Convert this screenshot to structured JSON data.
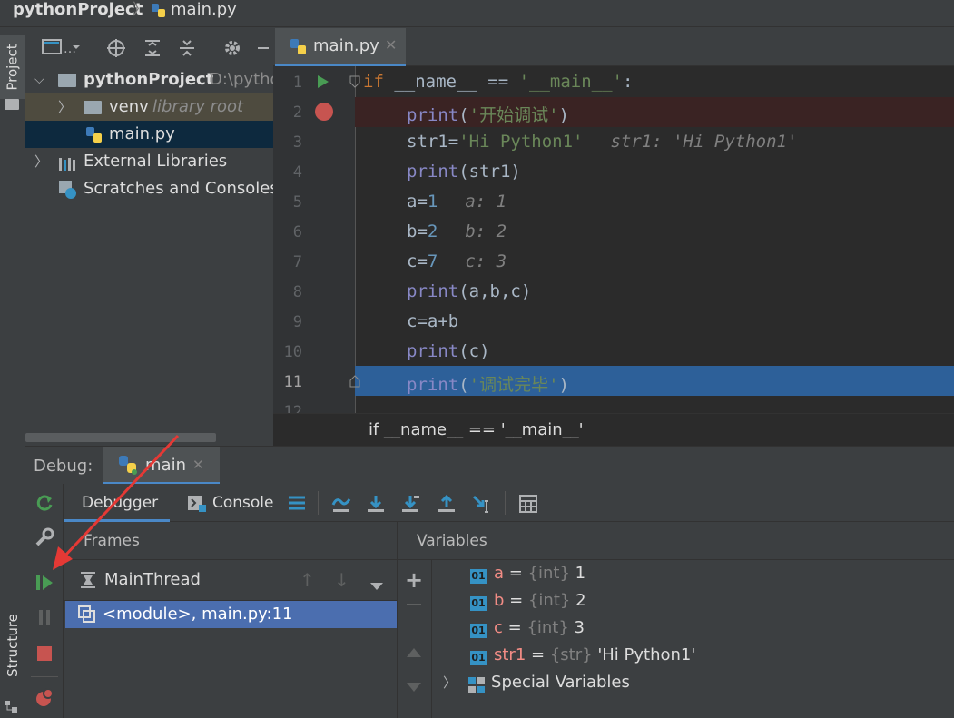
{
  "navbar": {
    "project": "pythonProject",
    "file": "main.py"
  },
  "side_tabs": {
    "project": "Project",
    "structure": "Structure"
  },
  "project_tree": {
    "root_name": "pythonProject",
    "root_path": "D:\\pytho",
    "venv": "venv",
    "venv_note": "library root",
    "file": "main.py",
    "ext_libs": "External Libraries",
    "scratches": "Scratches and Consoles"
  },
  "editor": {
    "tab_label": "main.py",
    "line_numbers": [
      "1",
      "2",
      "3",
      "4",
      "5",
      "6",
      "7",
      "8",
      "9",
      "10",
      "11",
      "12"
    ],
    "lines": [
      {
        "a": "if",
        "b": " __name__ == ",
        "c": "'__main__'",
        "d": ":"
      },
      {
        "a": "print",
        "b": "(",
        "c": "'开始调试'",
        "d": ")"
      },
      {
        "a": "str1=",
        "c": "'Hi Python1'",
        "inline": "str1: 'Hi Python1'"
      },
      {
        "a": "print",
        "b": "(str1)"
      },
      {
        "a": "a=",
        "c": "1",
        "inline": "a: 1"
      },
      {
        "a": "b=",
        "c": "2",
        "inline": "b: 2"
      },
      {
        "a": "c=",
        "c": "7",
        "inline": "c: 3"
      },
      {
        "a": "print",
        "b": "(a,b,c)"
      },
      {
        "a": "c=a+b"
      },
      {
        "a": "print",
        "b": "(c)"
      },
      {
        "a": "print",
        "b": "(",
        "c": "'调试完毕'",
        "d": ")"
      }
    ],
    "status": "if __name__ == '__main__'",
    "colors": {
      "breakpoint": "#c75450",
      "current_line": "#2d6099",
      "bp_line": "#3a2323"
    }
  },
  "debug": {
    "title": "Debug:",
    "config_tab": "main",
    "tabs": {
      "debugger": "Debugger",
      "console": "Console"
    },
    "frames_label": "Frames",
    "variables_label": "Variables",
    "thread": "MainThread",
    "frame": "<module>, main.py:11",
    "variables": [
      {
        "name": "a",
        "type": "{int}",
        "value": "1"
      },
      {
        "name": "b",
        "type": "{int}",
        "value": "2"
      },
      {
        "name": "c",
        "type": "{int}",
        "value": "3"
      },
      {
        "name": "str1",
        "type": "{str}",
        "value": "'Hi Python1'"
      }
    ],
    "special": "Special Variables",
    "var_badge": "01",
    "colors": {
      "accent": "#4a9c4a",
      "stop": "#c75450",
      "selection": "#4b6eaf",
      "arrow": "#e53935"
    }
  }
}
